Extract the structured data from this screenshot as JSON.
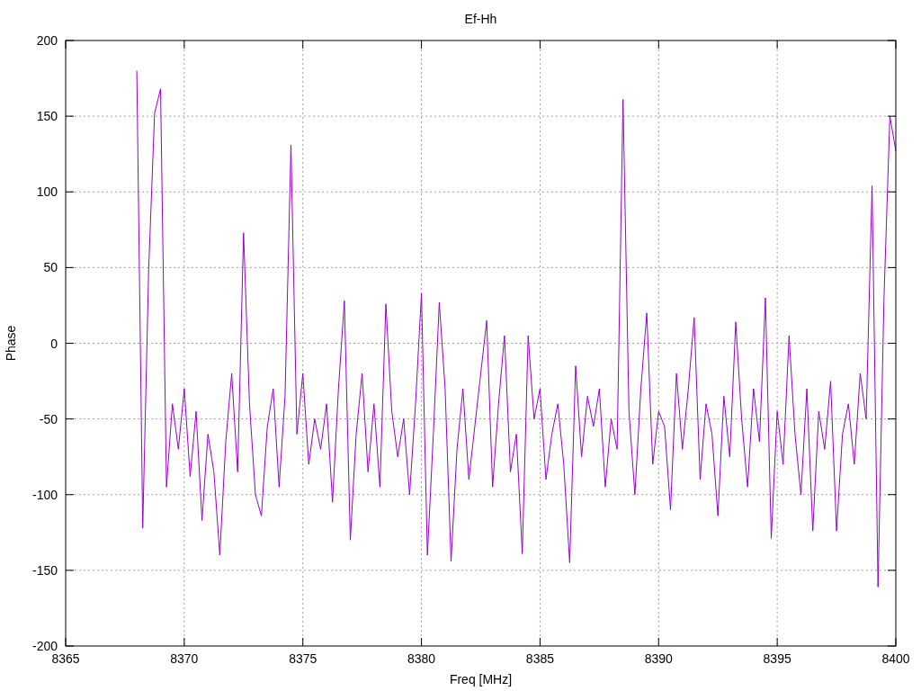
{
  "chart": {
    "chart_data": {
      "type": "line",
      "title": "Ef-Hh",
      "xlabel": "Freq [MHz]",
      "ylabel": "Phase",
      "grid": true,
      "xlim": [
        8365,
        8400
      ],
      "ylim": [
        -200,
        200
      ],
      "xticks": [
        8365,
        8370,
        8375,
        8380,
        8385,
        8390,
        8395,
        8400
      ],
      "yticks": [
        -200,
        -150,
        -100,
        -50,
        0,
        50,
        100,
        150,
        200
      ],
      "x": [
        8368,
        8368.25,
        8368.5,
        8368.75,
        8369,
        8369.25,
        8369.5,
        8369.75,
        8370,
        8370.25,
        8370.5,
        8370.75,
        8371,
        8371.25,
        8371.5,
        8371.75,
        8372,
        8372.25,
        8372.5,
        8372.75,
        8373,
        8373.25,
        8373.5,
        8373.75,
        8374,
        8374.25,
        8374.5,
        8374.75,
        8375,
        8375.25,
        8375.5,
        8375.75,
        8376,
        8376.25,
        8376.5,
        8376.75,
        8377,
        8377.25,
        8377.5,
        8377.75,
        8378,
        8378.25,
        8378.5,
        8378.75,
        8379,
        8379.25,
        8379.5,
        8379.75,
        8380,
        8380.25,
        8380.5,
        8380.75,
        8381,
        8381.25,
        8381.5,
        8381.75,
        8382,
        8382.25,
        8382.5,
        8382.75,
        8383,
        8383.25,
        8383.5,
        8383.75,
        8384,
        8384.25,
        8384.5,
        8384.75,
        8385,
        8385.25,
        8385.5,
        8385.75,
        8386,
        8386.25,
        8386.5,
        8386.75,
        8387,
        8387.25,
        8387.5,
        8387.75,
        8388,
        8388.25,
        8388.5,
        8388.75,
        8389,
        8389.25,
        8389.5,
        8389.75,
        8390,
        8390.25,
        8390.5,
        8390.75,
        8391,
        8391.25,
        8391.5,
        8391.75,
        8392,
        8392.25,
        8392.5,
        8392.75,
        8393,
        8393.25,
        8393.5,
        8393.75,
        8394,
        8394.25,
        8394.5,
        8394.75,
        8395,
        8395.25,
        8395.5,
        8395.75,
        8396,
        8396.25,
        8396.5,
        8396.75,
        8397,
        8397.25,
        8397.5,
        8397.75,
        8398,
        8398.25,
        8398.5,
        8398.75,
        8399,
        8399.25,
        8399.5,
        8399.75,
        8400
      ],
      "series": [
        {
          "color": "#9400d3",
          "values": [
            180,
            -122,
            49,
            152,
            168,
            -95,
            -40,
            -70,
            -30,
            -88,
            -45,
            -117,
            -60,
            -85,
            -140,
            -65,
            -20,
            -85,
            73,
            -40,
            -100,
            -114,
            -55,
            -30,
            -95,
            -35,
            131,
            -60,
            -20,
            -80,
            -50,
            -70,
            -40,
            -105,
            -30,
            28,
            -130,
            -60,
            -20,
            -85,
            -40,
            -95,
            26,
            -45,
            -75,
            -50,
            -100,
            -40,
            33,
            -140,
            -60,
            27,
            -30,
            -144,
            -70,
            -30,
            -90,
            -55,
            -20,
            15,
            -95,
            -40,
            5,
            -85,
            -60,
            -139,
            5,
            -50,
            -30,
            -90,
            -60,
            -40,
            -80,
            -145,
            -15,
            -75,
            -35,
            -55,
            -30,
            -95,
            -50,
            -70,
            161,
            -45,
            -100,
            -30,
            20,
            -80,
            -45,
            -55,
            -110,
            -20,
            -70,
            -30,
            17,
            -90,
            -40,
            -60,
            -114,
            -35,
            -75,
            14,
            -50,
            -95,
            -30,
            -65,
            30,
            -129,
            -45,
            -80,
            5,
            -60,
            -100,
            -30,
            -124,
            -45,
            -70,
            -25,
            -124,
            -60,
            -40,
            -80,
            -20,
            -50,
            104,
            -161,
            29,
            150,
            127
          ]
        }
      ]
    }
  }
}
